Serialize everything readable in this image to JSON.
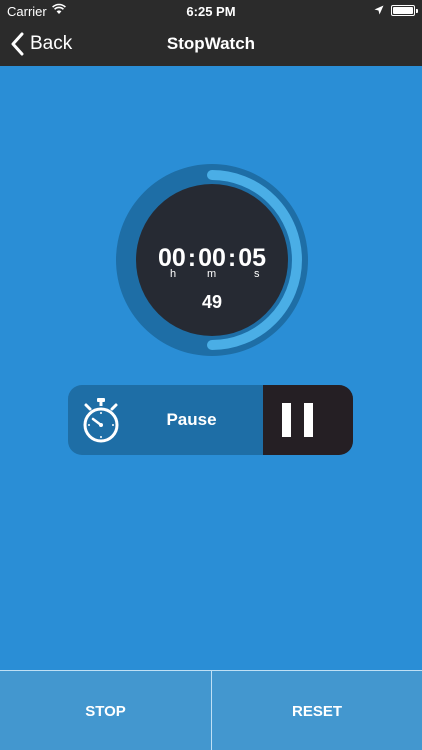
{
  "status_bar": {
    "carrier": "Carrier",
    "time": "6:25 PM",
    "icons": [
      "wifi-icon",
      "location-icon",
      "battery-icon"
    ]
  },
  "nav": {
    "back_label": "Back",
    "title": "StopWatch"
  },
  "timer": {
    "hours": "00",
    "minutes": "00",
    "seconds": "05",
    "separator": ":",
    "unit_h": "h",
    "unit_m": "m",
    "unit_s": "s",
    "centiseconds": "49",
    "progress_fraction": 0.5
  },
  "control": {
    "label": "Pause",
    "icons": [
      "stopwatch-icon",
      "pause-icon"
    ]
  },
  "bottom": {
    "stop_label": "STOP",
    "reset_label": "RESET"
  },
  "colors": {
    "background": "#2a8ed6",
    "bar": "#2b2b2b",
    "dial_outer": "#1e6ea6",
    "dial_inner": "#262a33",
    "progress": "#4aaee6",
    "pause_dark": "#251f24",
    "bottom_button": "#4397cf"
  }
}
